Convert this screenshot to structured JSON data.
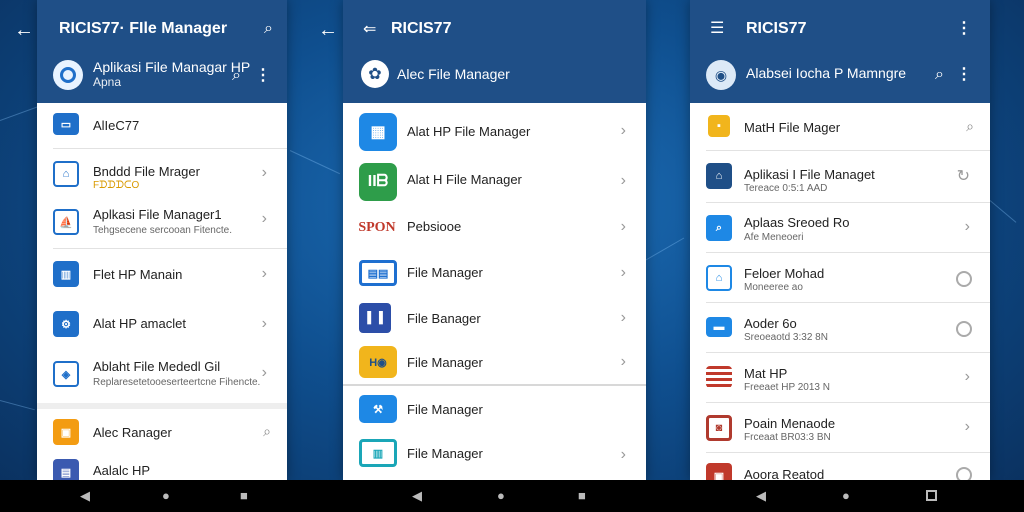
{
  "panel1": {
    "title": "RICIS77· FIle Manager",
    "sub_line1": "Aplikasi File Managar HP",
    "sub_line2": "Apna",
    "items": [
      {
        "label": "AlIeC77",
        "secondary": "",
        "icon": "folder-icon",
        "color": "#1f6fc9"
      },
      {
        "label": "Bnddd File Mrager",
        "secondary": "FᗪᗪᗪᑕO",
        "icon": "house-icon",
        "color": "#1f6fc9"
      },
      {
        "label": "Aplkasi File Manager1",
        "secondary": "Tehgsecene sercooan Fitencte.",
        "icon": "boat-icon",
        "color": "#1f6fc9"
      },
      {
        "label": "Flet HP Manain",
        "secondary": "",
        "icon": "building-icon",
        "color": "#1f6fc9"
      },
      {
        "label": "Alat HP amaclet",
        "secondary": "",
        "icon": "gear-person-icon",
        "color": "#1f6fc9"
      },
      {
        "label": "Ablaht File Mededl Gil",
        "secondary": "Replaresetetooeserteertcne Fihencte.",
        "icon": "box-icon",
        "color": "#1f6fc9"
      },
      {
        "label": "Alec Ranager",
        "secondary": "",
        "icon": "orange-app-icon",
        "color": "#f39c12"
      },
      {
        "label": "Aalalc HP",
        "secondary": "",
        "icon": "window-icon",
        "color": "#3b5ab0"
      }
    ]
  },
  "panel2": {
    "title": "RICIS77",
    "subtitle": "Alec File Manager",
    "items": [
      {
        "label": "Alat HP File Manager",
        "icon": "doc-app-icon",
        "color": "#1e88e5"
      },
      {
        "label": "Alat H File Manager",
        "icon": "green-app-icon",
        "color": "#2e9d4a"
      },
      {
        "label": "Pebsiooe",
        "icon": "spon-logo-icon",
        "color": "#c0392b",
        "logo": "SPON"
      },
      {
        "label": "File Manager",
        "icon": "blue-grid-icon",
        "color": "#1e6fd0"
      },
      {
        "label": "File Banager",
        "icon": "split-app-icon",
        "color": "#2c4ea8"
      },
      {
        "label": "File Manager",
        "icon": "yellow-app-icon",
        "color": "#f1b51c"
      },
      {
        "label": "File Manager",
        "icon": "tools-app-icon",
        "color": "#1e88e5"
      },
      {
        "label": "File Manager",
        "icon": "layout-app-icon",
        "color": "#1aa6b7"
      }
    ]
  },
  "panel3": {
    "title": "RICIS77",
    "subtitle": "Alabsei Iocha P Mamngre",
    "items": [
      {
        "label": "MatH File Mager",
        "secondary": "",
        "icon": "yellow-folder-icon",
        "color": "#f1b51c"
      },
      {
        "label": "Aplikasi I File Managet",
        "secondary": "Tereace 0:5:1 AAD",
        "icon": "home-icon",
        "color": "#1f4f87"
      },
      {
        "label": "Aplaas Sreoed Ro",
        "secondary": "Afe Meneoeri",
        "icon": "search-doc-icon",
        "color": "#1e88e5"
      },
      {
        "label": "Feloer Mohad",
        "secondary": "Moneeree ao",
        "icon": "house-outline-icon",
        "color": "#1e88e5"
      },
      {
        "label": "Aoder 6o",
        "secondary": "Sreoeaotd 3:32 8N",
        "icon": "card-icon",
        "color": "#1e88e5"
      },
      {
        "label": "Mat HP",
        "secondary": "Freeaet HP 2013 N",
        "icon": "flag-icon",
        "color": "#c0392b"
      },
      {
        "label": "Poain Menaode",
        "secondary": "Frceaat BR03:3 BN",
        "icon": "red-app-icon",
        "color": "#b03a2e"
      },
      {
        "label": "Aoora Reatod",
        "secondary": "",
        "icon": "red-box-icon",
        "color": "#c0392b"
      }
    ]
  },
  "nav": {
    "back": "◀",
    "home": "●",
    "recents": "■"
  }
}
